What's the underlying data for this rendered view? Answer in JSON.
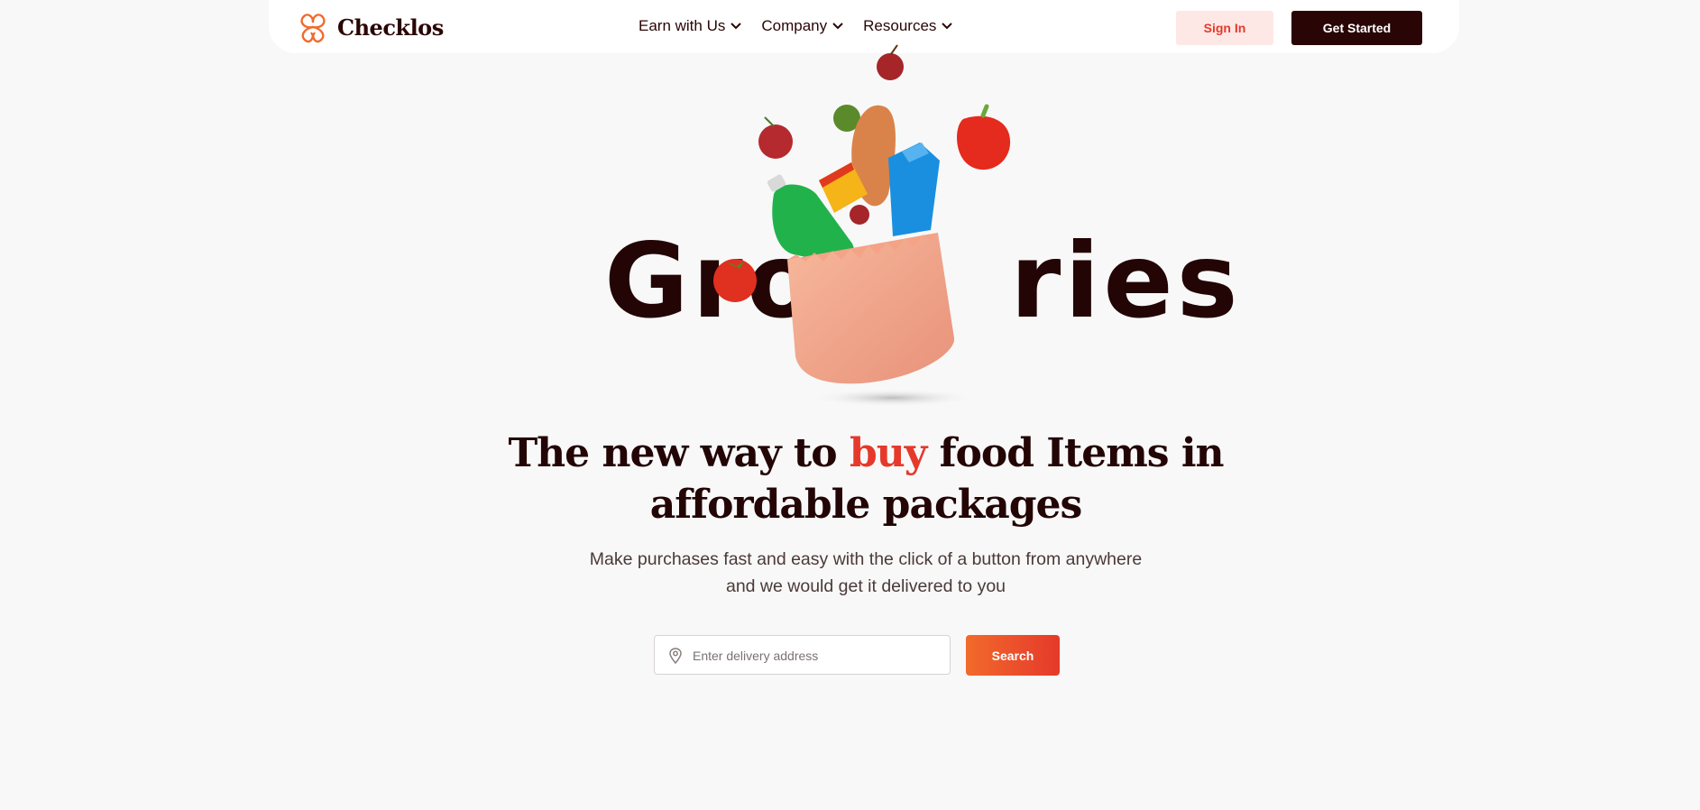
{
  "brand": {
    "name": "Checklos",
    "accent": "#e5392b",
    "dark": "#2a0505"
  },
  "nav": {
    "items": [
      {
        "label": "Earn with Us"
      },
      {
        "label": "Company"
      },
      {
        "label": "Resources"
      }
    ],
    "sign_in": "Sign In",
    "get_started": "Get Started"
  },
  "hero": {
    "big_word_left": "Gro",
    "big_word_right": "ries",
    "headline_part1": "The new way to ",
    "headline_accent": "buy",
    "headline_part2": " food Items in affordable packages",
    "subtext": "Make purchases fast and easy with the click of a button from anywhere and we would get it delivered to you"
  },
  "search": {
    "placeholder": "Enter delivery address",
    "button_label": "Search",
    "icon": "location-pin-icon"
  }
}
